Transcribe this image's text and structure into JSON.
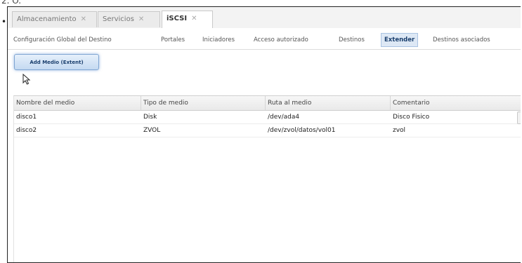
{
  "page": {
    "caption": "2. O.",
    "bullet": "•"
  },
  "main_tabs": [
    {
      "label": "Almacenamiento",
      "close": "✕",
      "active": false
    },
    {
      "label": "Servicios",
      "close": "✕",
      "active": false
    },
    {
      "label": "iSCSI",
      "close": "✕",
      "active": true
    }
  ],
  "sub_tabs": [
    {
      "label": "Configuración Global del Destino",
      "active": false
    },
    {
      "label": "Portales",
      "active": false
    },
    {
      "label": "Iniciadores",
      "active": false
    },
    {
      "label": "Acceso autorizado",
      "active": false
    },
    {
      "label": "Destinos",
      "active": false
    },
    {
      "label": "Extender",
      "active": true
    },
    {
      "label": "Destinos asociados",
      "active": false
    }
  ],
  "actions": {
    "add_label": "Add Medio (Extent)"
  },
  "table": {
    "columns": [
      "Nombre del medio",
      "Tipo de medio",
      "Ruta al medio",
      "Comentario"
    ],
    "rows": [
      [
        "disco1",
        "Disk",
        "/dev/ada4",
        "Disco Fisico"
      ],
      [
        "disco2",
        "ZVOL",
        "/dev/zvol/datos/vol01",
        "zvol"
      ]
    ]
  },
  "colors": {
    "accent": "#dde8f5",
    "accent_border": "#aac3e2",
    "button_border": "#7fa5d2"
  }
}
